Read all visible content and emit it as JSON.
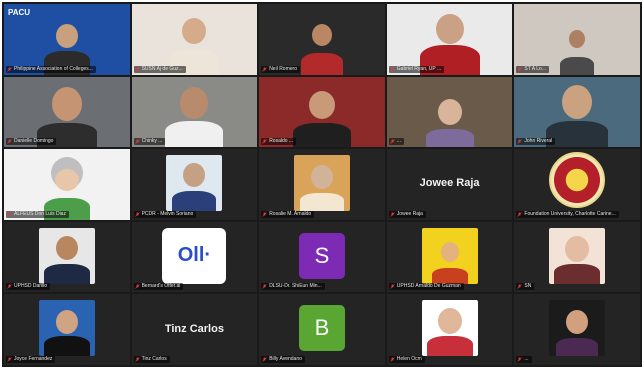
{
  "meeting": {
    "tiles": [
      {
        "name": "Philippine Association of Colleges...",
        "muted": true,
        "kind": "video",
        "bg": "#1f4fa3",
        "logo_text": "PACU"
      },
      {
        "name": "SUSN Aj de Guz...",
        "muted": true,
        "kind": "video",
        "bg": "#e9e3dc"
      },
      {
        "name": "Neil Romero",
        "muted": true,
        "kind": "video",
        "bg": "#2a2a2a"
      },
      {
        "name": "Gabriel Ryan, UP ...",
        "muted": true,
        "kind": "video",
        "bg": "#eaeaea"
      },
      {
        "name": "ST A Lo...",
        "muted": true,
        "kind": "video",
        "bg": "#cfc8c0"
      },
      {
        "name": "Danielle Domingo",
        "muted": true,
        "kind": "video",
        "bg": "#6b6f73"
      },
      {
        "name": "Chinky ...",
        "muted": true,
        "kind": "video",
        "bg": "#8a8a86"
      },
      {
        "name": "Rosaldo ...",
        "muted": true,
        "kind": "video",
        "bg": "#8c2a2a"
      },
      {
        "name": "...",
        "muted": true,
        "kind": "video",
        "bg": "#6a5a4a"
      },
      {
        "name": "John Riveral",
        "muted": true,
        "kind": "video",
        "bg": "#4c6a7d"
      },
      {
        "name": "ALFEUS Don Luis Diaz",
        "muted": true,
        "kind": "video",
        "bg": "#f2f2f2"
      },
      {
        "name": "PCDR - Melvin Soriano",
        "muted": true,
        "kind": "photo",
        "bg": "#242424"
      },
      {
        "name": "Rosalie M. Arnaldo",
        "muted": true,
        "kind": "photo",
        "bg": "#242424"
      },
      {
        "name": "Jowee Raja",
        "muted": true,
        "kind": "name",
        "display": "Jowee Raja"
      },
      {
        "name": "Foundation University, Charlotte Carine...",
        "muted": true,
        "kind": "seal"
      },
      {
        "name": "UPHSD Danilo",
        "muted": true,
        "kind": "photo",
        "bg": "#242424"
      },
      {
        "name": "Bernard's Otter.ai",
        "muted": true,
        "kind": "otter",
        "display": "Oll·"
      },
      {
        "name": "DLSU-Dr. ShiEun Min...",
        "muted": true,
        "kind": "letter",
        "display": "S",
        "color": "#7d2bb5"
      },
      {
        "name": "UPHSD Arnaldo De Guzman",
        "muted": true,
        "kind": "photo",
        "bg": "#242424"
      },
      {
        "name": "SN",
        "muted": true,
        "kind": "photo",
        "bg": "#242424"
      },
      {
        "name": "Joyce Fernandez",
        "muted": true,
        "kind": "photo",
        "bg": "#242424"
      },
      {
        "name": "Tinz Carlos",
        "muted": true,
        "kind": "name",
        "display": "Tinz Carlos"
      },
      {
        "name": "Billy Avendano",
        "muted": true,
        "kind": "letter",
        "display": "B",
        "color": "#5aa632"
      },
      {
        "name": "Helen Ocm",
        "muted": true,
        "kind": "photo",
        "bg": "#242424"
      },
      {
        "name": "...",
        "muted": true,
        "kind": "photo",
        "bg": "#242424"
      }
    ]
  },
  "colors": {
    "muted": "#e23b3b",
    "grid_bg": "#1a1a1a"
  }
}
